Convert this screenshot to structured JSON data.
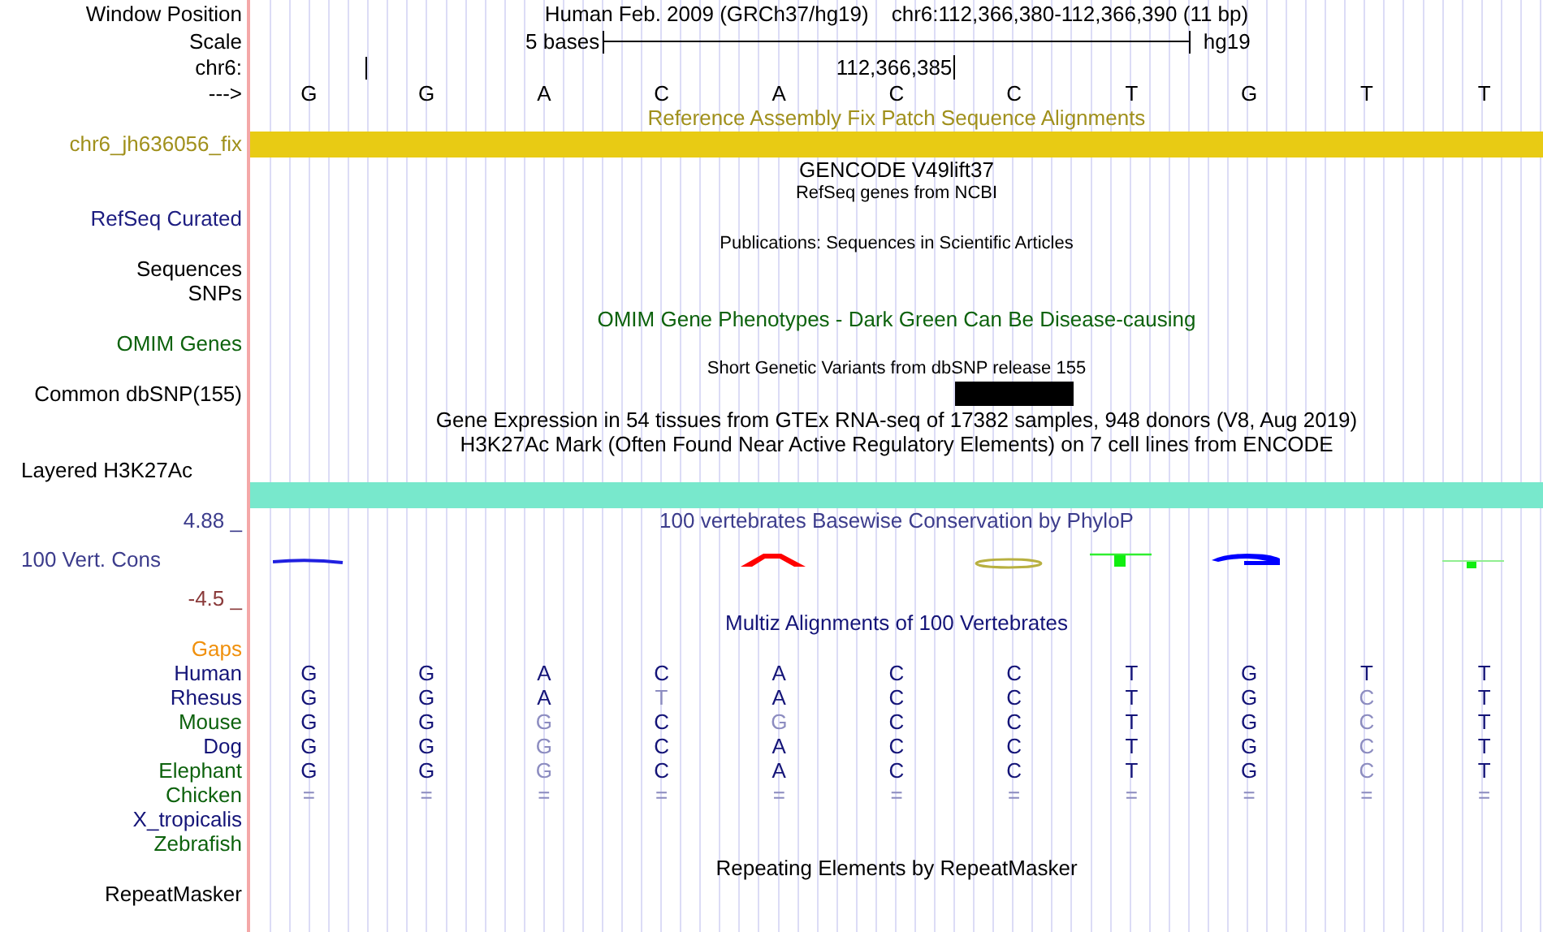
{
  "position": {
    "label": "Window Position",
    "assembly": "Human Feb. 2009 (GRCh37/hg19)",
    "range": "chr6:112,366,380-112,366,390 (11 bp)"
  },
  "scale": {
    "label": "Scale",
    "length": "5 bases",
    "assembly": "hg19"
  },
  "ruler": {
    "label": "chr6:",
    "coordinate": "112,366,385"
  },
  "strand": {
    "label": "--->",
    "bases": [
      "G",
      "G",
      "A",
      "C",
      "A",
      "C",
      "C",
      "T",
      "G",
      "T",
      "T"
    ]
  },
  "rows": [
    {
      "kind": "caption",
      "text": "Reference Assembly Fix Patch Sequence Alignments",
      "color": "#a0901c"
    },
    {
      "kind": "bar",
      "label": "chr6_jh636056_fix",
      "color": "#e8cb14"
    },
    {
      "kind": "caption",
      "text": "GENCODE V49lift37",
      "color": "#000000"
    },
    {
      "kind": "subcaption",
      "text": "RefSeq genes from NCBI",
      "color": "#000000"
    },
    {
      "kind": "label",
      "label": "RefSeq Curated",
      "color": "#1c1c80"
    },
    {
      "kind": "subcaption",
      "text": "Publications: Sequences in Scientific Articles",
      "color": "#000000"
    },
    {
      "kind": "label",
      "label": "Sequences",
      "color": "#000000"
    },
    {
      "kind": "label",
      "label": "SNPs",
      "color": "#000000"
    },
    {
      "kind": "caption",
      "text": "OMIM Gene Phenotypes - Dark Green Can Be Disease-causing",
      "color": "#0d620d"
    },
    {
      "kind": "label",
      "label": "OMIM Genes",
      "color": "#0d620d"
    },
    {
      "kind": "subcaption",
      "text": "Short Genetic Variants from dbSNP release 155",
      "color": "#000000"
    },
    {
      "kind": "feature",
      "label": "Common dbSNP(155)",
      "color": "#000000"
    },
    {
      "kind": "caption",
      "text": "Gene Expression in 54 tissues from GTEx RNA-seq of 17382 samples, 948 donors (V8, Aug 2019)",
      "color": "#000000"
    },
    {
      "kind": "caption",
      "text": "H3K27Ac Mark (Often Found Near Active Regulatory Elements) on 7 cell lines from ENCODE",
      "color": "#000000"
    },
    {
      "kind": "label-left",
      "label": "Layered H3K27Ac",
      "color": "#000000"
    },
    {
      "kind": "bar",
      "color": "#78e8cc"
    },
    {
      "kind": "caption",
      "label": "4.88 _",
      "text": "100 vertebrates Basewise Conservation by PhyloP",
      "color": "#3c3c8c"
    },
    {
      "kind": "logo",
      "label": "100 Vert. Cons",
      "color": "#3c3c8c"
    },
    {
      "kind": "label",
      "label": "-4.5 _",
      "color": "#8a3a3a"
    },
    {
      "kind": "caption",
      "text": "Multiz Alignments of 100 Vertebrates",
      "color": "#141478"
    },
    {
      "kind": "label",
      "label": "Gaps",
      "color": "#f0900c"
    },
    {
      "kind": "alignment",
      "label": "Human",
      "color": "#141478",
      "bases": [
        {
          "base": "G",
          "match": true
        },
        {
          "base": "G",
          "match": true
        },
        {
          "base": "A",
          "match": true
        },
        {
          "base": "C",
          "match": true
        },
        {
          "base": "A",
          "match": true
        },
        {
          "base": "C",
          "match": true
        },
        {
          "base": "C",
          "match": true
        },
        {
          "base": "T",
          "match": true
        },
        {
          "base": "G",
          "match": true
        },
        {
          "base": "T",
          "match": true
        },
        {
          "base": "T",
          "match": true
        }
      ]
    },
    {
      "kind": "alignment",
      "label": "Rhesus",
      "color": "#141478",
      "bases": [
        {
          "base": "G",
          "match": true
        },
        {
          "base": "G",
          "match": true
        },
        {
          "base": "A",
          "match": true
        },
        {
          "base": "T",
          "match": false
        },
        {
          "base": "A",
          "match": true
        },
        {
          "base": "C",
          "match": true
        },
        {
          "base": "C",
          "match": true
        },
        {
          "base": "T",
          "match": true
        },
        {
          "base": "G",
          "match": true
        },
        {
          "base": "C",
          "match": false
        },
        {
          "base": "T",
          "match": true
        }
      ]
    },
    {
      "kind": "alignment",
      "label": "Mouse",
      "color": "#0d620d",
      "bases": [
        {
          "base": "G",
          "match": true
        },
        {
          "base": "G",
          "match": true
        },
        {
          "base": "G",
          "match": false
        },
        {
          "base": "C",
          "match": true
        },
        {
          "base": "G",
          "match": false
        },
        {
          "base": "C",
          "match": true
        },
        {
          "base": "C",
          "match": true
        },
        {
          "base": "T",
          "match": true
        },
        {
          "base": "G",
          "match": true
        },
        {
          "base": "C",
          "match": false
        },
        {
          "base": "T",
          "match": true
        }
      ]
    },
    {
      "kind": "alignment",
      "label": "Dog",
      "color": "#141478",
      "bases": [
        {
          "base": "G",
          "match": true
        },
        {
          "base": "G",
          "match": true
        },
        {
          "base": "G",
          "match": false
        },
        {
          "base": "C",
          "match": true
        },
        {
          "base": "A",
          "match": true
        },
        {
          "base": "C",
          "match": true
        },
        {
          "base": "C",
          "match": true
        },
        {
          "base": "T",
          "match": true
        },
        {
          "base": "G",
          "match": true
        },
        {
          "base": "C",
          "match": false
        },
        {
          "base": "T",
          "match": true
        }
      ]
    },
    {
      "kind": "alignment",
      "label": "Elephant",
      "color": "#0d620d",
      "bases": [
        {
          "base": "G",
          "match": true
        },
        {
          "base": "G",
          "match": true
        },
        {
          "base": "G",
          "match": false
        },
        {
          "base": "C",
          "match": true
        },
        {
          "base": "A",
          "match": true
        },
        {
          "base": "C",
          "match": true
        },
        {
          "base": "C",
          "match": true
        },
        {
          "base": "T",
          "match": true
        },
        {
          "base": "G",
          "match": true
        },
        {
          "base": "C",
          "match": false
        },
        {
          "base": "T",
          "match": true
        }
      ]
    },
    {
      "kind": "alignment",
      "label": "Chicken",
      "color": "#0d620d",
      "bases": [
        {
          "base": "=",
          "match": false
        },
        {
          "base": "=",
          "match": false
        },
        {
          "base": "=",
          "match": false
        },
        {
          "base": "=",
          "match": false
        },
        {
          "base": "=",
          "match": false
        },
        {
          "base": "=",
          "match": false
        },
        {
          "base": "=",
          "match": false
        },
        {
          "base": "=",
          "match": false
        },
        {
          "base": "=",
          "match": false
        },
        {
          "base": "=",
          "match": false
        },
        {
          "base": "=",
          "match": false
        }
      ]
    },
    {
      "kind": "alignment",
      "label": "X_tropicalis",
      "color": "#141478"
    },
    {
      "kind": "alignment",
      "label": "Zebrafish",
      "color": "#0d620d"
    },
    {
      "kind": "caption",
      "text": "Repeating Elements by RepeatMasker",
      "color": "#000000"
    },
    {
      "kind": "label",
      "label": "RepeatMasker",
      "color": "#000000"
    }
  ]
}
